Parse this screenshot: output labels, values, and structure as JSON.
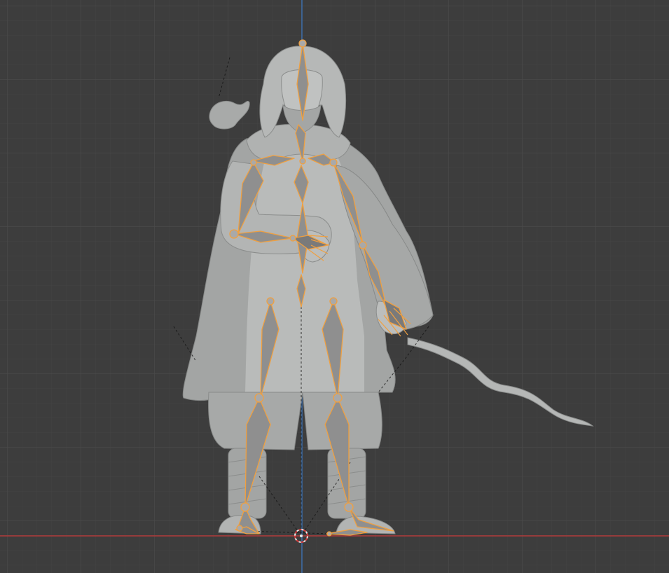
{
  "viewport": {
    "background": "#3d3d3d",
    "grid_minor_color": "#434343",
    "grid_major_color": "#4a4a4a",
    "x_axis_color": "#b13a3a",
    "z_axis_color": "#3b6fb0",
    "bone_outline_color": "#f0a040"
  },
  "icons": {
    "origin": "3d-cursor-icon"
  }
}
